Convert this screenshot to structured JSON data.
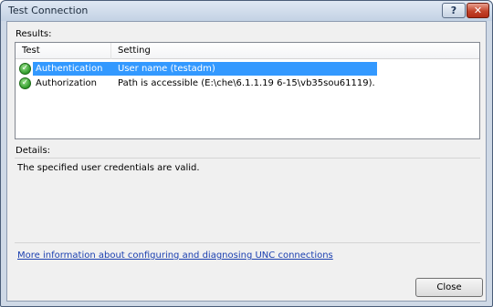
{
  "window": {
    "title": "Test Connection",
    "help_glyph": "?",
    "close_glyph": "✕"
  },
  "results": {
    "label": "Results:",
    "columns": [
      "Test",
      "Setting"
    ],
    "rows": [
      {
        "test": "Authentication",
        "setting": "User name (testadm)",
        "status": "success",
        "selected": true
      },
      {
        "test": "Authorization",
        "setting": "Path is accessible (E:\\che\\6.1.1.19 6-15\\vb35sou61119).",
        "status": "success",
        "selected": false
      }
    ]
  },
  "details": {
    "label": "Details:",
    "text": "The specified user credentials are valid."
  },
  "link_text": "More information about configuring and diagnosing UNC connections",
  "close_button": "Close",
  "colors": {
    "selection": "#3399ff",
    "link": "#1a3fb0",
    "success": "#2f9a2a"
  }
}
